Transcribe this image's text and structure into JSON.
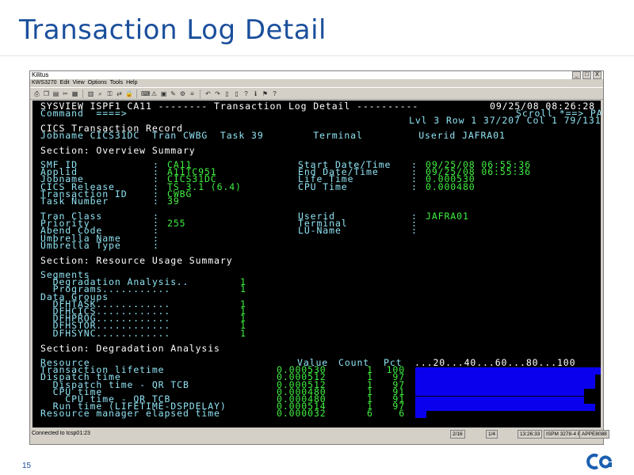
{
  "slide": {
    "title": "Transaction Log Detail",
    "number": "15"
  },
  "window": {
    "title": "Kilitus",
    "menu": [
      "KWS3270",
      "Edit",
      "View",
      "Options",
      "Tools",
      "Help"
    ],
    "buttons": {
      "minimize": "_",
      "maximize": "□",
      "close": "X"
    }
  },
  "toolbar": {
    "icons": [
      "print-icon",
      "copy-icon",
      "paste-icon",
      "cut-icon",
      "macro-icon",
      "table-icon",
      "search-icon",
      "key-icon",
      "transfer-icon",
      "lock-icon",
      "keyboard-icon",
      "alert-icon",
      "save-icon",
      "edit-icon",
      "settings-icon",
      "list-icon",
      "undo-icon",
      "redo-icon",
      "page-icon",
      "page-icon",
      "help-icon",
      "info-icon",
      "flag-icon",
      "help-icon"
    ]
  },
  "screen": {
    "header1": {
      "left": "SYSVIEW ISPF1 CA11 -------- Transaction Log Detail ----------",
      "right": "09/25/08 08:26:28"
    },
    "header2": {
      "command_label": "Command  ====>",
      "scroll": "Scroll *==> PAGE"
    },
    "header3": {
      "label": "Lvl 3 Row 1 37/207 Col 1 79/131"
    },
    "record_title": "CICS Transaction Record",
    "record_line": "Jobname CICS31DC  Tran CWBG  Task 39        Terminal         Userid JAFRA01",
    "section1": "Section: Overview Summary",
    "overview_left": [
      {
        "label": "SMF ID",
        "value": "CA11"
      },
      {
        "label": "Applid",
        "value": "A11TC951"
      },
      {
        "label": "Jobname",
        "value": "CICS31DC"
      },
      {
        "label": "CICS Release",
        "value": "TS 3.1 (6.4)"
      },
      {
        "label": "Transaction ID",
        "value": "CWBG"
      },
      {
        "label": "Task Number",
        "value": "39"
      }
    ],
    "overview_right": [
      {
        "label": "Start Date/Time",
        "value": "09/25/08 06:55:36"
      },
      {
        "label": "End Date/Time",
        "value": "09/25/08 06:55:36"
      },
      {
        "label": "Life Time",
        "value": "0.000530"
      },
      {
        "label": "CPU Time",
        "value": "0.000480"
      }
    ],
    "overview2_left": [
      {
        "label": "Tran Class",
        "value": ""
      },
      {
        "label": "Priority",
        "value": "255"
      },
      {
        "label": "Abend Code",
        "value": ""
      },
      {
        "label": "Umbrella Name",
        "value": ""
      },
      {
        "label": "Umbrella Type",
        "value": ""
      }
    ],
    "overview2_right": [
      {
        "label": "Userid",
        "value": "JAFRA01"
      },
      {
        "label": "Terminal",
        "value": ""
      },
      {
        "label": "LU-Name",
        "value": ""
      }
    ],
    "section2": "Section: Resource Usage Summary",
    "usage": [
      {
        "label": "Segments",
        "dots": "",
        "value": ""
      },
      {
        "label": "  Degradation Analysis",
        "dots": "..",
        "value": "1"
      },
      {
        "label": "  Programs",
        "dots": "...........",
        "value": "1"
      },
      {
        "label": "Data Groups",
        "dots": "",
        "value": ""
      },
      {
        "label": "  DFHTASK",
        "dots": "............",
        "value": "1"
      },
      {
        "label": "  DFHCICS",
        "dots": "............",
        "value": "1"
      },
      {
        "label": "  DFHPROG",
        "dots": "............",
        "value": "1"
      },
      {
        "label": "  DFHSTOR",
        "dots": "............",
        "value": "1"
      },
      {
        "label": "  DFHSYNC",
        "dots": "............",
        "value": "1"
      }
    ],
    "section3": "Section: Degradation Analysis",
    "degr_header": {
      "resource": "Resource",
      "value": "Value",
      "count": "Count",
      "pct": "Pct",
      "scale": "...20...40...60...80...100"
    },
    "degr_rows": [
      {
        "resource": "Transaction lifetime",
        "value": "0.000530",
        "count": "1",
        "pct": "100",
        "pct_num": 100
      },
      {
        "resource": "Dispatch time",
        "value": "0.000512",
        "count": "1",
        "pct": "97",
        "pct_num": 97
      },
      {
        "resource": "  Dispatch time - QR TCB",
        "value": "0.000512",
        "count": "1",
        "pct": "97",
        "pct_num": 97
      },
      {
        "resource": "  CPU time",
        "value": "0.000480",
        "count": "1",
        "pct": "91",
        "pct_num": 91
      },
      {
        "resource": "    CPU time - QR TCB",
        "value": "0.000480",
        "count": "1",
        "pct": "91",
        "pct_num": 91
      },
      {
        "resource": "  Run time (LIFETIME-DSPDELAY)",
        "value": "0.000514",
        "count": "1",
        "pct": "97",
        "pct_num": 97
      },
      {
        "resource": "Resource manager elapsed time",
        "value": "0.000032",
        "count": "6",
        "pct": "6",
        "pct_num": 6
      }
    ],
    "colors": {
      "background": "#000000",
      "text_white": "#ffffff",
      "text_cyan": "#8fe3f3",
      "text_green": "#3fef3f",
      "bar_blue": "#0a00ee"
    }
  },
  "statusbar": {
    "message": "Connected to tcsp01:23",
    "fields": [
      "2/16",
      "1/4",
      "13:26:33",
      "ISPM 3278-4 E",
      "APPE8088"
    ]
  }
}
